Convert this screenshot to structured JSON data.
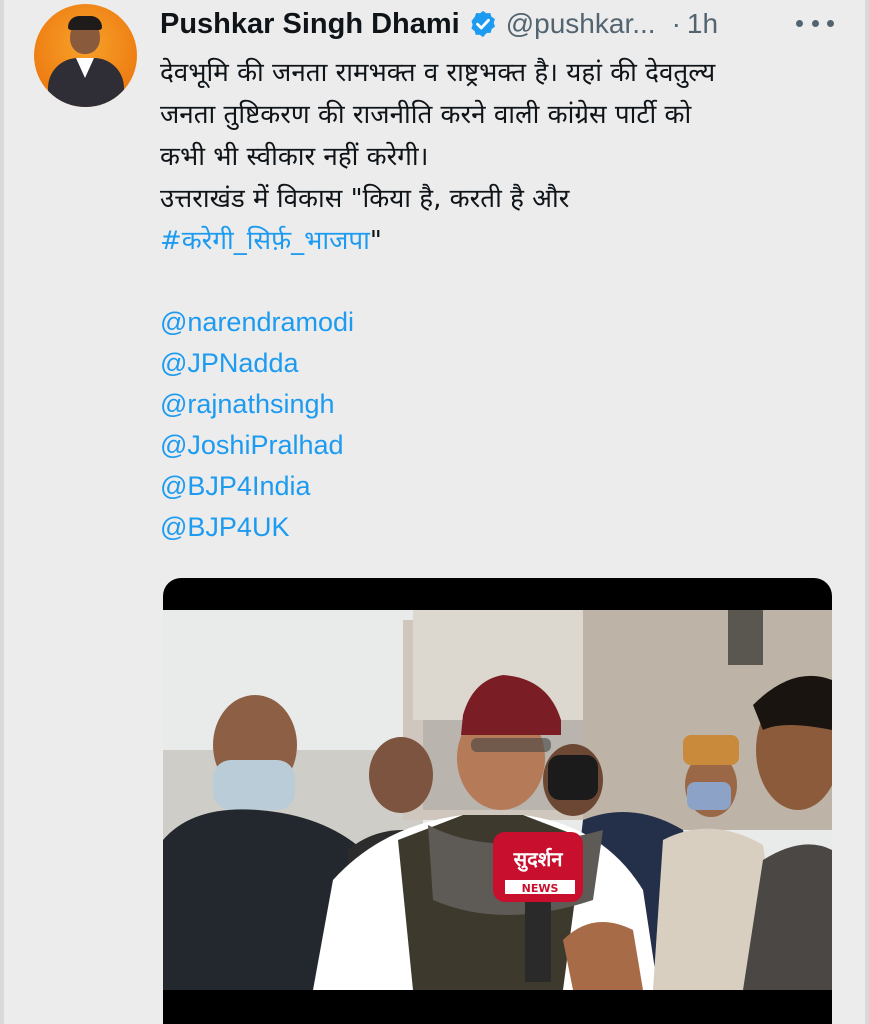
{
  "tweet": {
    "author": {
      "display_name": "Pushkar Singh Dhami",
      "handle": "@pushkar...",
      "verified": true,
      "avatar_icon": "profile-photo"
    },
    "separator": "·",
    "time": "1h",
    "more_icon": "more-horizontal-icon",
    "text_lines": [
      "देवभूमि की जनता रामभक्त व राष्ट्रभक्त है। यहां की देवतुल्य",
      "जनता तुष्टिकरण की राजनीति करने वाली कांग्रेस पार्टी को",
      "कभी भी स्वीकार नहीं करेगी।",
      "उत्तराखंड में विकास \"किया है, करती है और"
    ],
    "hashtag": "#करेगी_सिर्फ़_भाजपा",
    "hashtag_suffix": "\"",
    "mentions": [
      "@narendramodi",
      "@JPNadda",
      "@rajnathsingh",
      "@JoshiPralhad",
      "@BJP4India",
      "@BJP4UK"
    ],
    "media": {
      "mic_brand": "सुदर्शन",
      "mic_sub": "NEWS"
    }
  },
  "colors": {
    "link": "#1d9bf0",
    "text": "#0f1419",
    "secondary": "#536471",
    "background": "#ececec"
  }
}
